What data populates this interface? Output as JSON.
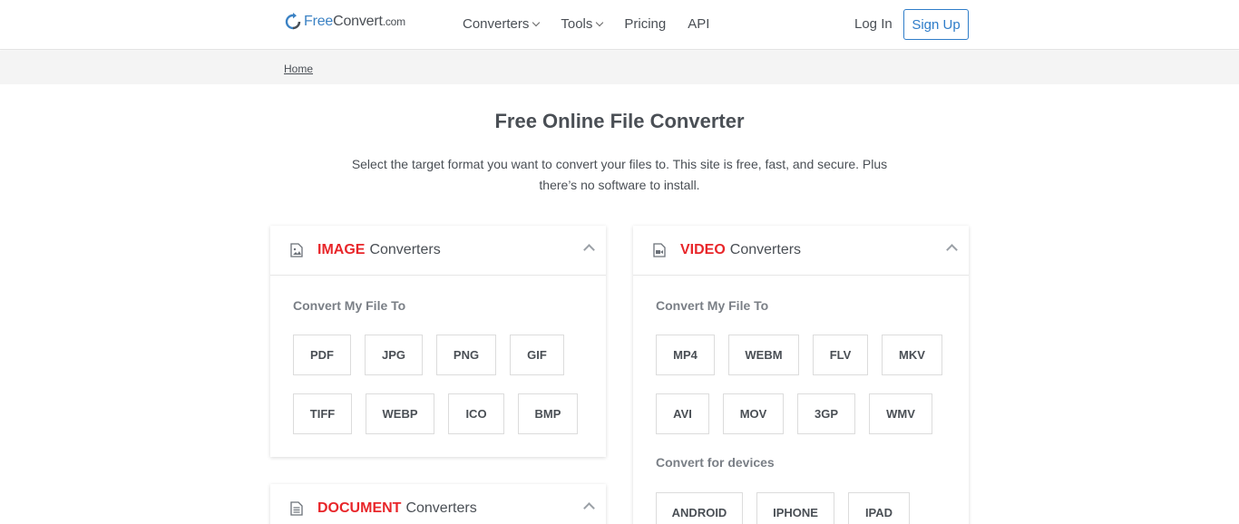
{
  "header": {
    "logo": {
      "brand_blue": "Free",
      "brand_dark": "Convert",
      "tld": ".com"
    },
    "nav": [
      {
        "label": "Converters",
        "has_dropdown": true
      },
      {
        "label": "Tools",
        "has_dropdown": true
      },
      {
        "label": "Pricing",
        "has_dropdown": false
      },
      {
        "label": "API",
        "has_dropdown": false
      }
    ],
    "login_label": "Log In",
    "signup_label": "Sign Up"
  },
  "breadcrumb": {
    "home": "Home"
  },
  "hero": {
    "title": "Free Online File Converter",
    "subtitle": "Select the target format you want to convert your files to. This site is free, fast, and secure. Plus there’s no software to install."
  },
  "cards": {
    "image": {
      "highlight": "IMAGE",
      "rest": "Converters",
      "section_label": "Convert My File To",
      "formats": [
        "PDF",
        "JPG",
        "PNG",
        "GIF",
        "TIFF",
        "WEBP",
        "ICO",
        "BMP"
      ]
    },
    "video": {
      "highlight": "VIDEO",
      "rest": "Converters",
      "section_label": "Convert My File To",
      "formats": [
        "MP4",
        "WEBM",
        "FLV",
        "MKV",
        "AVI",
        "MOV",
        "3GP",
        "WMV"
      ],
      "devices_label": "Convert for devices",
      "devices": [
        "ANDROID",
        "IPHONE",
        "IPAD"
      ]
    },
    "document": {
      "highlight": "DOCUMENT",
      "rest": "Converters"
    }
  },
  "colors": {
    "accent_red": "#e8262a",
    "link_blue": "#2f7dc9",
    "text": "#4a4f55"
  }
}
